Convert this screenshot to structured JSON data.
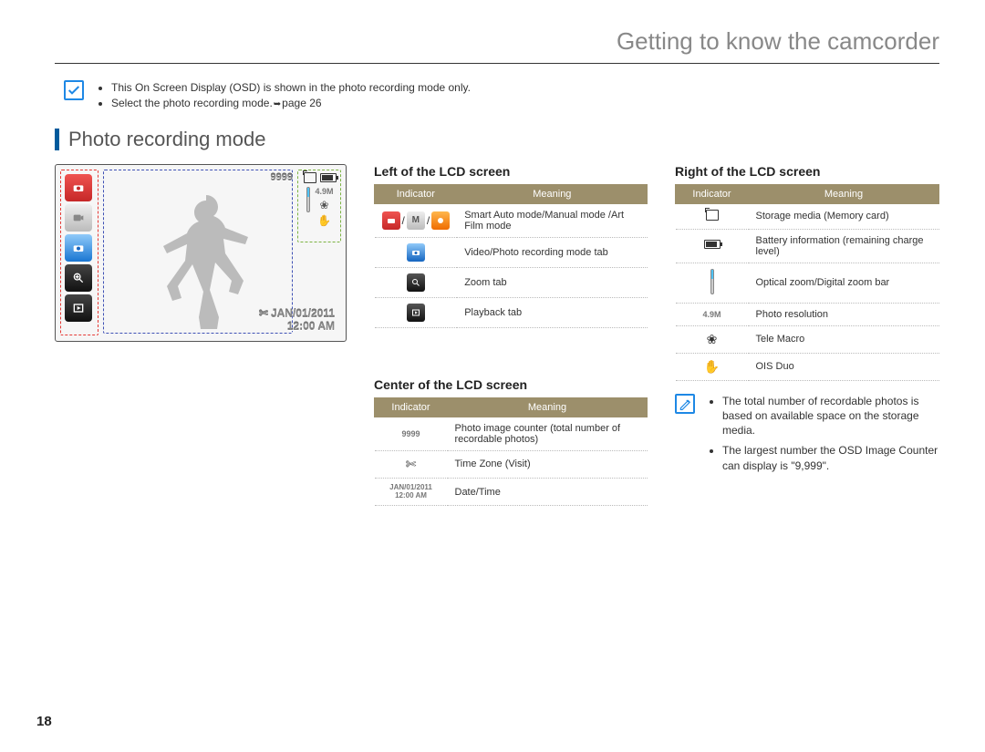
{
  "header": {
    "title": "Getting to know the camcorder"
  },
  "intro": {
    "bullets": [
      "This On Screen Display (OSD) is shown in the photo recording mode only.",
      "Select the photo recording mode."
    ],
    "page_ref": "page 26"
  },
  "section": {
    "title": "Photo recording mode"
  },
  "lcd": {
    "counter": "9999",
    "resolution": "4.9M",
    "date": "JAN/01/2011",
    "time": "12:00 AM"
  },
  "left_table": {
    "heading": "Left of the LCD screen",
    "cols": [
      "Indicator",
      "Meaning"
    ],
    "rows": [
      {
        "icon": "mode-trio",
        "meaning": "Smart Auto mode/Manual mode /Art Film mode"
      },
      {
        "icon": "rec-tab",
        "meaning": "Video/Photo recording mode tab"
      },
      {
        "icon": "zoom-tab",
        "meaning": "Zoom tab"
      },
      {
        "icon": "play-tab",
        "meaning": "Playback tab"
      }
    ]
  },
  "center_table": {
    "heading": "Center of the LCD screen",
    "cols": [
      "Indicator",
      "Meaning"
    ],
    "rows": [
      {
        "icon": "counter",
        "label": "9999",
        "meaning": "Photo image counter (total number of recordable photos)"
      },
      {
        "icon": "timezone",
        "meaning": "Time Zone (Visit)"
      },
      {
        "icon": "datetime",
        "line1": "JAN/01/2011",
        "line2": "12:00 AM",
        "meaning": "Date/Time"
      }
    ]
  },
  "right_table": {
    "heading": "Right of the LCD screen",
    "cols": [
      "Indicator",
      "Meaning"
    ],
    "rows": [
      {
        "icon": "card",
        "meaning": "Storage media (Memory card)"
      },
      {
        "icon": "battery",
        "meaning": "Battery information (remaining charge level)"
      },
      {
        "icon": "zoombar",
        "meaning": "Optical zoom/Digital zoom bar"
      },
      {
        "icon": "res",
        "label": "4.9M",
        "meaning": "Photo resolution"
      },
      {
        "icon": "flower",
        "meaning": "Tele Macro"
      },
      {
        "icon": "hand",
        "meaning": "OIS Duo"
      }
    ]
  },
  "notes": {
    "bullets": [
      "The total number of recordable photos is based on available space on the storage media.",
      "The largest number the OSD Image Counter can display is \"9,999\"."
    ]
  },
  "page_number": "18"
}
